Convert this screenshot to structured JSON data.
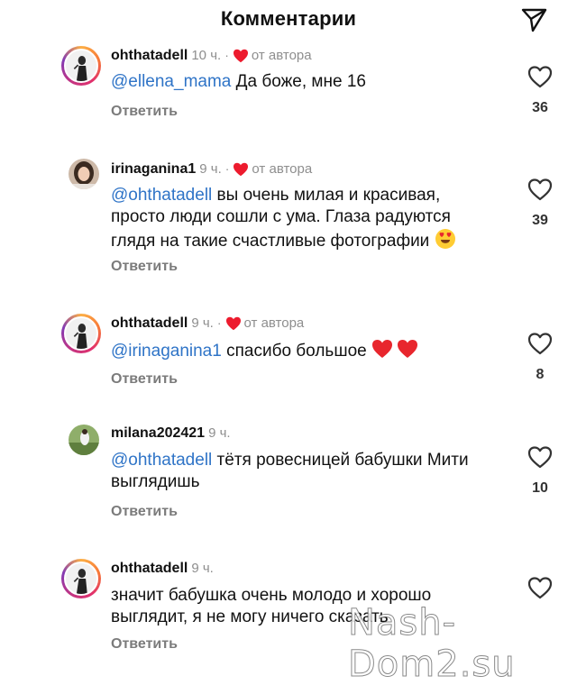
{
  "header": {
    "title": "Комментарии"
  },
  "colors": {
    "mention": "#2f74c7",
    "heart": "#ed1b2e",
    "muted": "#8e8e8e"
  },
  "comments": [
    {
      "username": "ohthatadell",
      "time": "10 ч.",
      "dot": "·",
      "author_like": "от автора",
      "mention": "@ellena_mama",
      "text": " Да боже, мне 16",
      "reply": "Ответить",
      "likes": "36"
    },
    {
      "username": "irinaganina1",
      "time": "9 ч.",
      "dot": "·",
      "author_like": "от автора",
      "mention": "@ohthatadell",
      "text": " вы очень милая и красивая, просто люди сошли с ума. Глаза радуются глядя на такие счастливые фотографии",
      "reply": "Ответить",
      "likes": "39"
    },
    {
      "username": "ohthatadell",
      "time": "9 ч.",
      "dot": "·",
      "author_like": "от автора",
      "mention": "@irinaganina1",
      "text": " спасибо большое ",
      "reply": "Ответить",
      "likes": "8"
    },
    {
      "username": "milana202421",
      "time": "9 ч.",
      "mention": "@ohthatadell",
      "text": " тётя ровесницей бабушки Мити выглядишь",
      "reply": "Ответить",
      "likes": "10"
    },
    {
      "username": "ohthatadell",
      "time": "9 ч.",
      "text": "значит бабушка очень молодо и хорошо выглядит, я не могу ничего сказать",
      "reply": "Ответить"
    }
  ],
  "watermark": "Nash-Dom2.su"
}
